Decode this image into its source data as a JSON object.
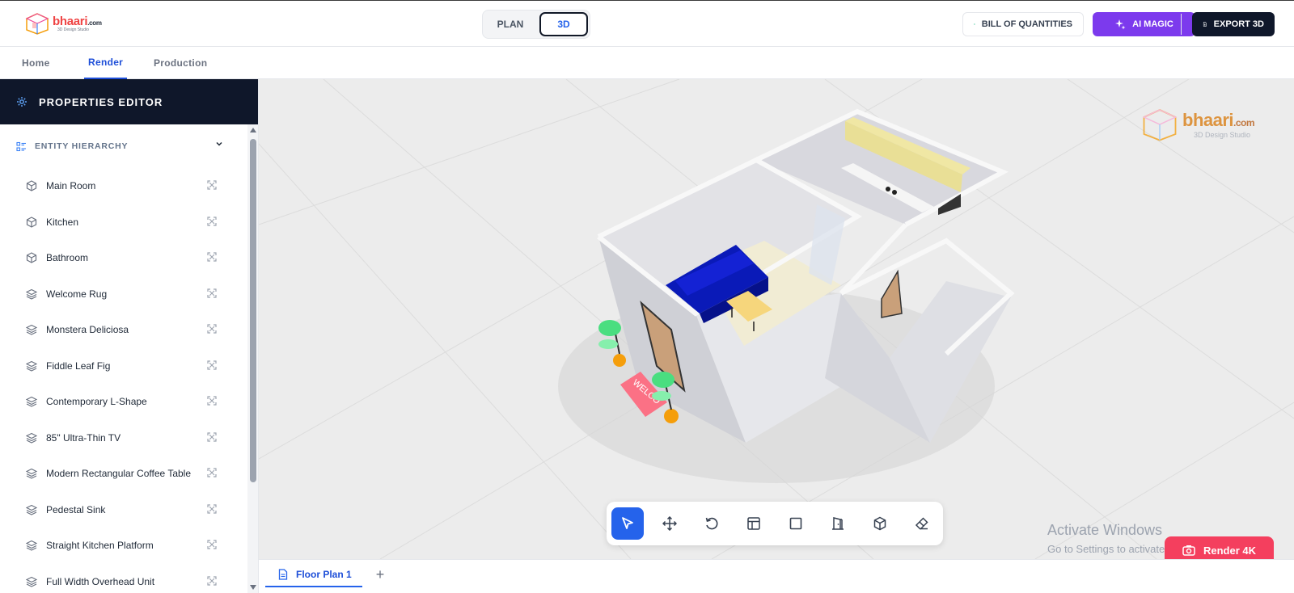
{
  "header": {
    "logo_text": "bhaari",
    "logo_suffix": ".com",
    "logo_subtitle": "3D Design Studio",
    "mode_plan": "PLAN",
    "mode_3d": "3D",
    "boq_label": "BILL OF QUANTITIES",
    "ai_label": "AI MAGIC",
    "export_label": "EXPORT 3D"
  },
  "nav": {
    "tabs": [
      {
        "label": "Home"
      },
      {
        "label": "Render",
        "active": true
      },
      {
        "label": "Production"
      }
    ]
  },
  "panel": {
    "title": "PROPERTIES EDITOR",
    "section_label": "ENTITY HIERARCHY",
    "entities": [
      {
        "label": "Main Room",
        "icon": "cube-icon"
      },
      {
        "label": "Kitchen",
        "icon": "cube-icon"
      },
      {
        "label": "Bathroom",
        "icon": "cube-icon"
      },
      {
        "label": "Welcome Rug",
        "icon": "layers-icon"
      },
      {
        "label": "Monstera Deliciosa",
        "icon": "layers-icon"
      },
      {
        "label": "Fiddle Leaf Fig",
        "icon": "layers-icon"
      },
      {
        "label": "Contemporary L-Shape",
        "icon": "layers-icon"
      },
      {
        "label": "85\" Ultra-Thin TV",
        "icon": "layers-icon"
      },
      {
        "label": "Modern Rectangular Coffee Table",
        "icon": "layers-icon"
      },
      {
        "label": "Pedestal Sink",
        "icon": "layers-icon"
      },
      {
        "label": "Straight Kitchen Platform",
        "icon": "layers-icon"
      },
      {
        "label": "Full Width Overhead Unit",
        "icon": "layers-icon"
      }
    ]
  },
  "viewport": {
    "watermark_text": "bhaari",
    "watermark_suffix": ".com",
    "watermark_subtitle": "3D Design Studio",
    "rug_text": "WELCO",
    "activate_title": "Activate Windows",
    "activate_sub": "Go to Settings to activate Windows.",
    "render_label": "Render 4K"
  },
  "toolbar": {
    "tools": [
      "select-tool",
      "move-tool",
      "rotate-tool",
      "layout-tool",
      "room-tool",
      "door-tool",
      "object-tool",
      "eraser-tool"
    ],
    "active_tool": "select-tool"
  },
  "bottom": {
    "floor_tab": "Floor Plan 1",
    "add_tab": "+"
  },
  "colors": {
    "accent": "#2563eb",
    "ai_purple": "#7c3aed",
    "dark": "#0f172a",
    "render_pink": "#f43f5e",
    "sofa_blue": "#0a1ab8"
  }
}
